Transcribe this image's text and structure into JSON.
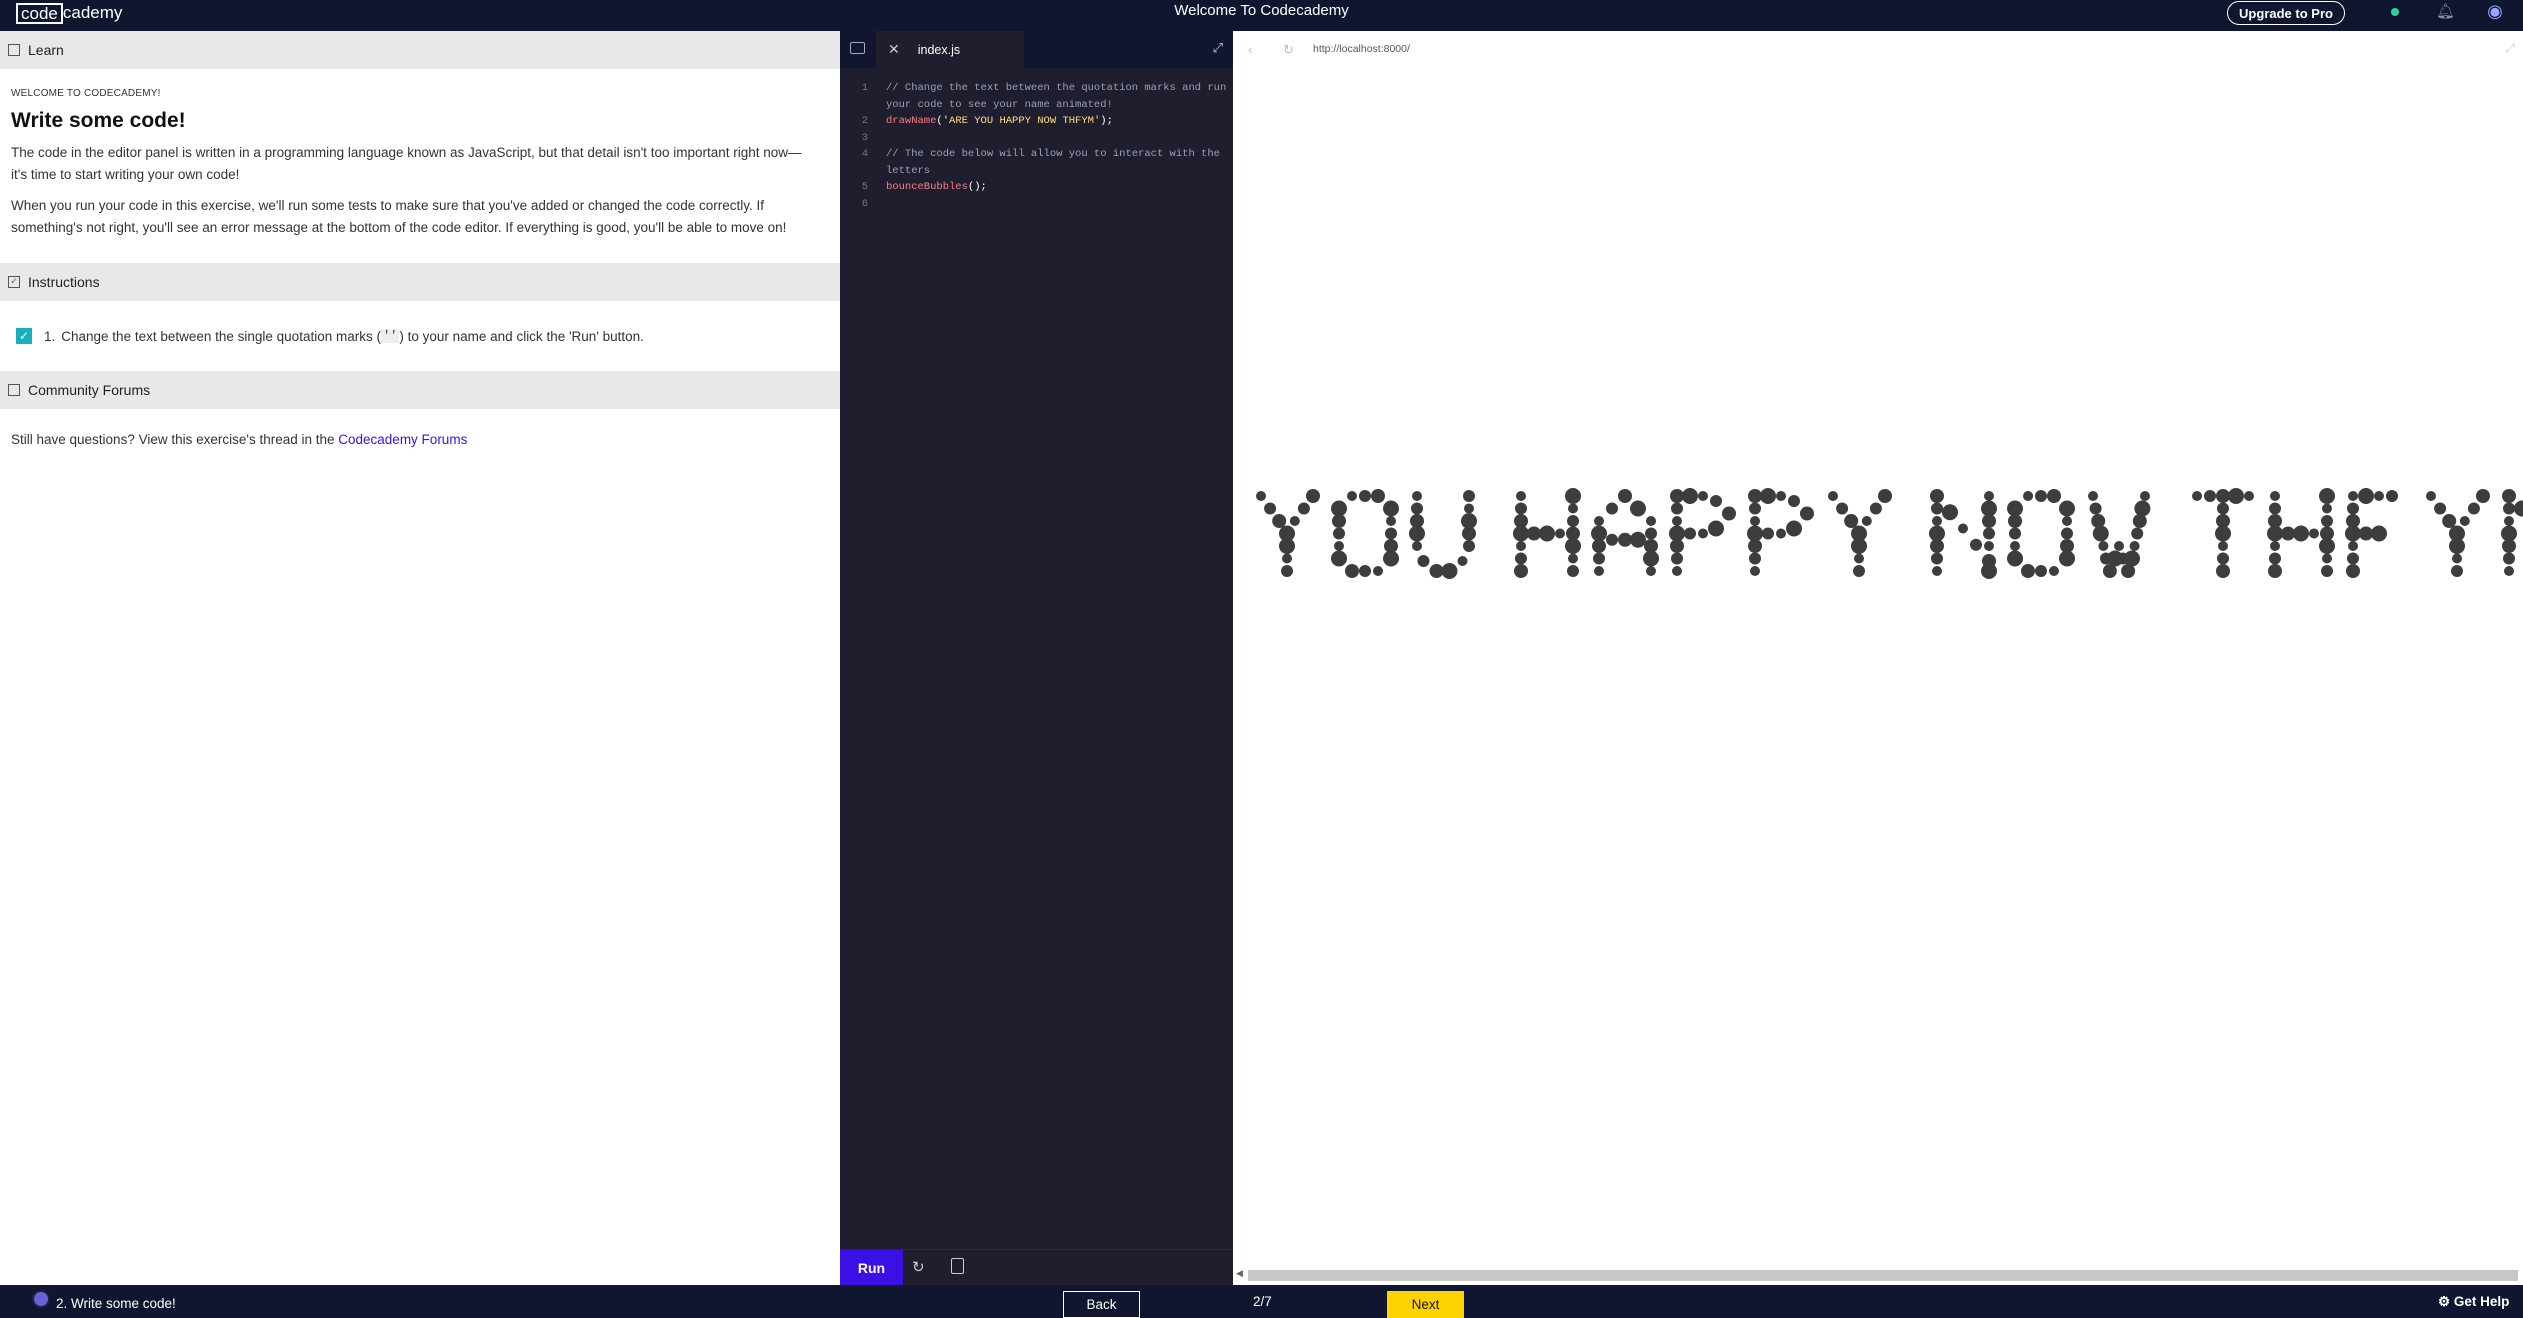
{
  "header": {
    "logo_left": "code",
    "logo_right": "cademy",
    "title": "Welcome To Codecademy",
    "upgrade_label": "Upgrade to Pro"
  },
  "learn": {
    "section_label": "Learn",
    "eyebrow": "WELCOME TO CODECADEMY!",
    "heading": "Write some code!",
    "paragraphs": [
      "The code in the editor panel is written in a programming language known as JavaScript, but that detail isn't too important right now—it's time to start writing your own code!",
      "When you run your code in this exercise, we'll run some tests to make sure that you've added or changed the code correctly. If something's not right, you'll see an error message at the bottom of the code editor. If everything is good, you'll be able to move on!"
    ]
  },
  "instructions": {
    "section_label": "Instructions",
    "tasks": [
      {
        "number": "1.",
        "text_before": "Change the text between the single quotation marks (",
        "code": "''",
        "text_after": ") to your name and click the 'Run' button.",
        "checked": true
      }
    ]
  },
  "community": {
    "section_label": "Community Forums",
    "text": "Still have questions? View this exercise's thread in the ",
    "link": "Codecademy Forums"
  },
  "editor": {
    "tab_name": "index.js",
    "lines": [
      {
        "num": "1",
        "comment": "// Change the text between the quotation marks and run your code to see your name animated!"
      },
      {
        "num": "2",
        "fn": "drawName",
        "open": "(",
        "str": "'ARE YOU HAPPY NOW THFYM'",
        "close": ");"
      },
      {
        "num": "3"
      },
      {
        "num": "4",
        "comment": "// The code below will allow you to interact with the letters"
      },
      {
        "num": "5",
        "fn": "bounceBubbles",
        "open": "(",
        "str": "",
        "close": ");"
      },
      {
        "num": "6"
      }
    ],
    "run_label": "Run"
  },
  "browser": {
    "url": "http://localhost:8000/",
    "visible_text": "YOU HAPPY NOW THFYM",
    "bubble_color": "#3d3d3d"
  },
  "footer": {
    "exercise": "2. Write some code!",
    "back_label": "Back",
    "progress": "2/7",
    "next_label": "Next",
    "help_label": "Get Help"
  },
  "colors": {
    "nav_bg": "#10162f",
    "accent": "#3a10e5",
    "next": "#ffd300",
    "check": "#1bb0b8"
  }
}
